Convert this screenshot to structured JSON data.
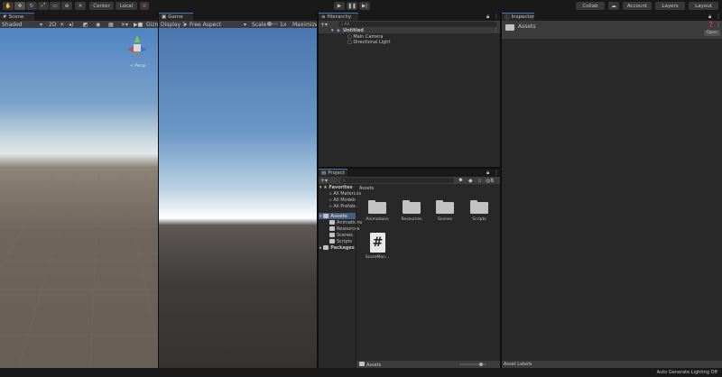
{
  "toolbar": {
    "pivot_label": "Center",
    "space_label": "Local",
    "collab_label": "Collab",
    "account_label": "Account",
    "layers_label": "Layers",
    "layout_label": "Layout"
  },
  "scene": {
    "tab_label": "Scene",
    "shading": "Shaded",
    "mode_2d": "2D",
    "gizmos_label": "Gizmo",
    "persp_label": "< Persp"
  },
  "game": {
    "tab_label": "Game",
    "display": "Display 1",
    "aspect": "Free Aspect",
    "scale_label": "Scale",
    "scale_value": "1x",
    "maximize_label": "Maximize"
  },
  "hierarchy": {
    "tab_label": "Hierarchy",
    "search_placeholder": "All",
    "scene_name": "Untitled",
    "objects": [
      "Main Camera",
      "Directional Light"
    ]
  },
  "inspector": {
    "tab_label": "Inspector",
    "title": "Assets",
    "open_label": "Open",
    "asset_labels": "Asset Labels"
  },
  "project": {
    "tab_label": "Project",
    "breadcrumb": "Assets",
    "hidden_count": "8",
    "favorites_label": "Favorites",
    "favorites": [
      "All Materials",
      "All Models",
      "All Prefabs"
    ],
    "assets_label": "Assets",
    "asset_folders": [
      "Animations",
      "Resources",
      "Scenes",
      "Scripts"
    ],
    "packages_label": "Packages",
    "grid_folders": [
      "Animations",
      "Resources",
      "Scenes",
      "Scripts"
    ],
    "grid_script": "ScoreMan...",
    "script_glyph": "#",
    "footer_path": "Assets"
  },
  "status": {
    "lighting": "Auto Generate Lighting Off"
  },
  "colors": {
    "accent": "#3a79bb",
    "panel": "#282828",
    "toolbar": "#191919"
  }
}
